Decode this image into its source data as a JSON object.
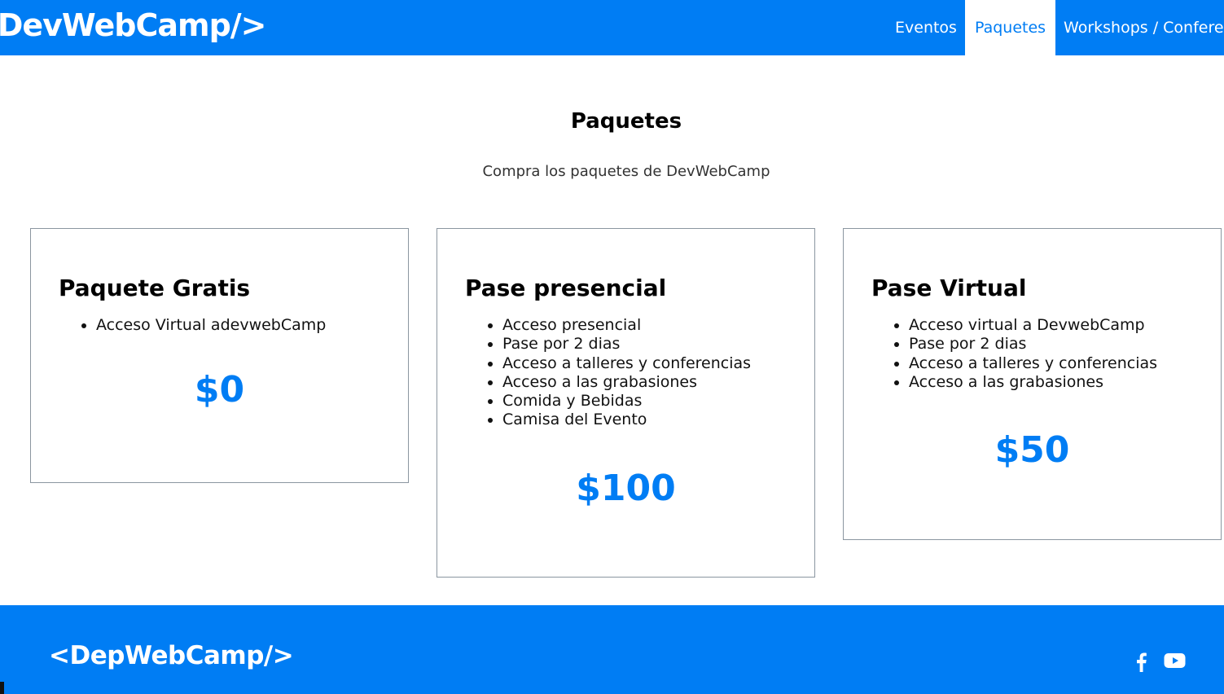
{
  "header": {
    "brand": "<DevWebCamp/>",
    "nav": [
      {
        "label": "Eventos",
        "active": false
      },
      {
        "label": "Paquetes",
        "active": true
      },
      {
        "label": "Workshops / Conferencias",
        "active": false
      }
    ]
  },
  "page": {
    "title": "Paquetes",
    "subtitle": "Compra los paquetes de DevWebCamp"
  },
  "packages": [
    {
      "name": "Paquete Gratis",
      "features": [
        "Acceso Virtual adevwebCamp"
      ],
      "price": "$0"
    },
    {
      "name": "Pase presencial",
      "features": [
        "Acceso presencial",
        "Pase por 2 dias",
        "Acceso a talleres y conferencias",
        "Acceso a las grabasiones",
        "Comida y Bebidas",
        "Camisa del Evento"
      ],
      "price": "$100"
    },
    {
      "name": "Pase Virtual",
      "features": [
        "Acceso virtual a DevwebCamp",
        "Pase por 2 dias",
        "Acceso a talleres y conferencias",
        "Acceso a las grabasiones"
      ],
      "price": "$50"
    }
  ],
  "footer": {
    "logo": "<DepWebCamp/>",
    "social": [
      {
        "icon": "facebook-icon"
      },
      {
        "icon": "youtube-icon"
      }
    ]
  },
  "colors": {
    "accent": "#007df4",
    "text": "#000000",
    "card_border": "#8b96a0"
  }
}
